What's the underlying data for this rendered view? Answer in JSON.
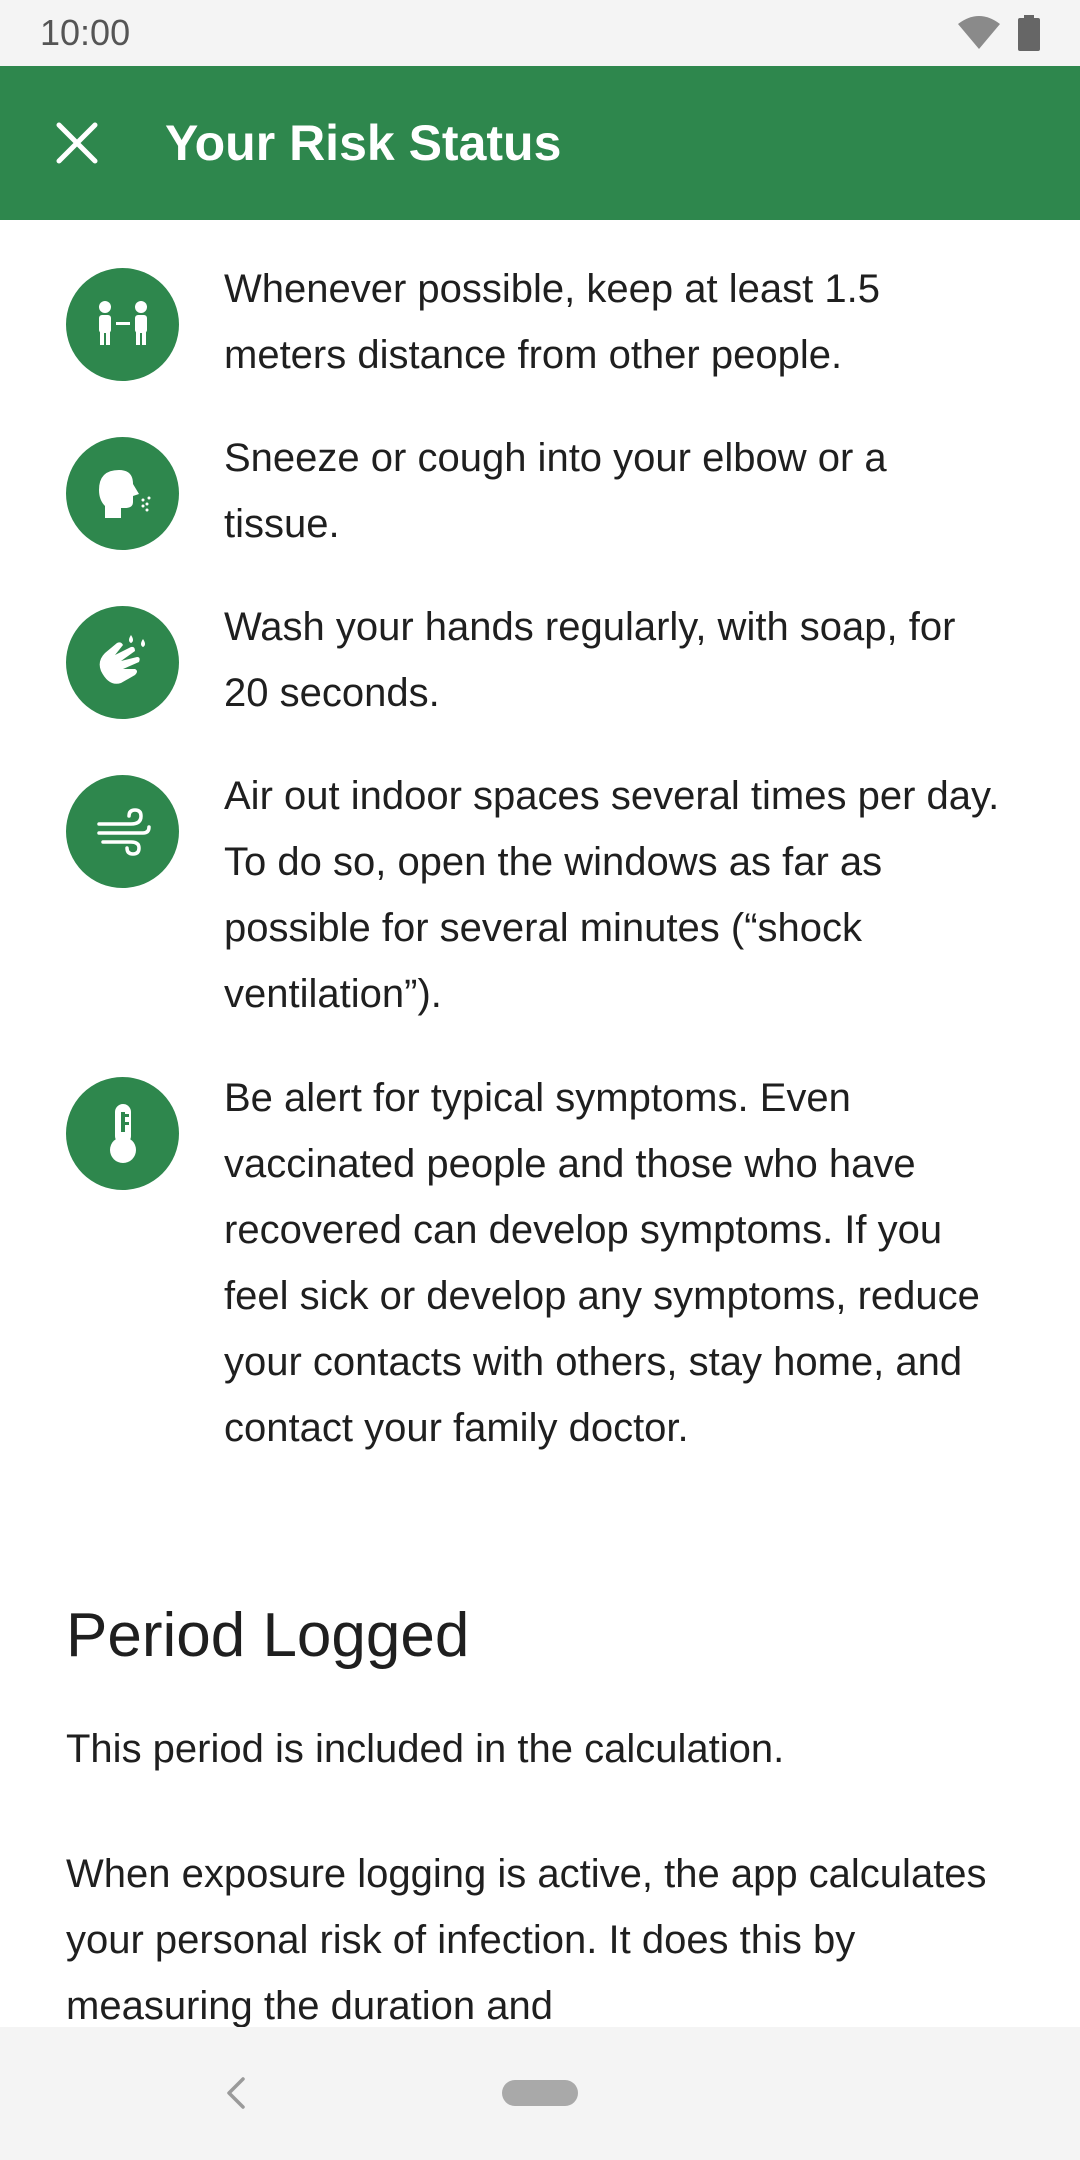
{
  "status_bar": {
    "time": "10:00"
  },
  "app_bar": {
    "title": "Your Risk Status",
    "close_icon": "close-icon"
  },
  "tips": [
    {
      "icon": "distance-icon",
      "text": "Whenever possible, keep at least 1.5 meters distance from other people."
    },
    {
      "icon": "sneeze-icon",
      "text": "Sneeze or cough into your elbow or a tissue."
    },
    {
      "icon": "hand-wash-icon",
      "text": "Wash your hands regularly, with soap, for 20 seconds."
    },
    {
      "icon": "ventilation-icon",
      "text": "Air out indoor spaces several times per day. To do so, open the windows as far as possible for several minutes (“shock ventilation”)."
    },
    {
      "icon": "thermometer-icon",
      "text": "Be alert for typical symptoms. Even vaccinated people and those who have recovered can develop symptoms. If you feel sick or develop any symptoms, reduce your contacts with others, stay home, and contact your family doctor."
    }
  ],
  "period_section": {
    "title": "Period Logged",
    "subtitle": "This period is included in the calculation.",
    "body": "When exposure logging is active, the app calculates your personal risk of infection. It does this by measuring the duration and"
  },
  "colors": {
    "brand_green": "#2e874d",
    "bar_background": "#f4f4f4"
  }
}
